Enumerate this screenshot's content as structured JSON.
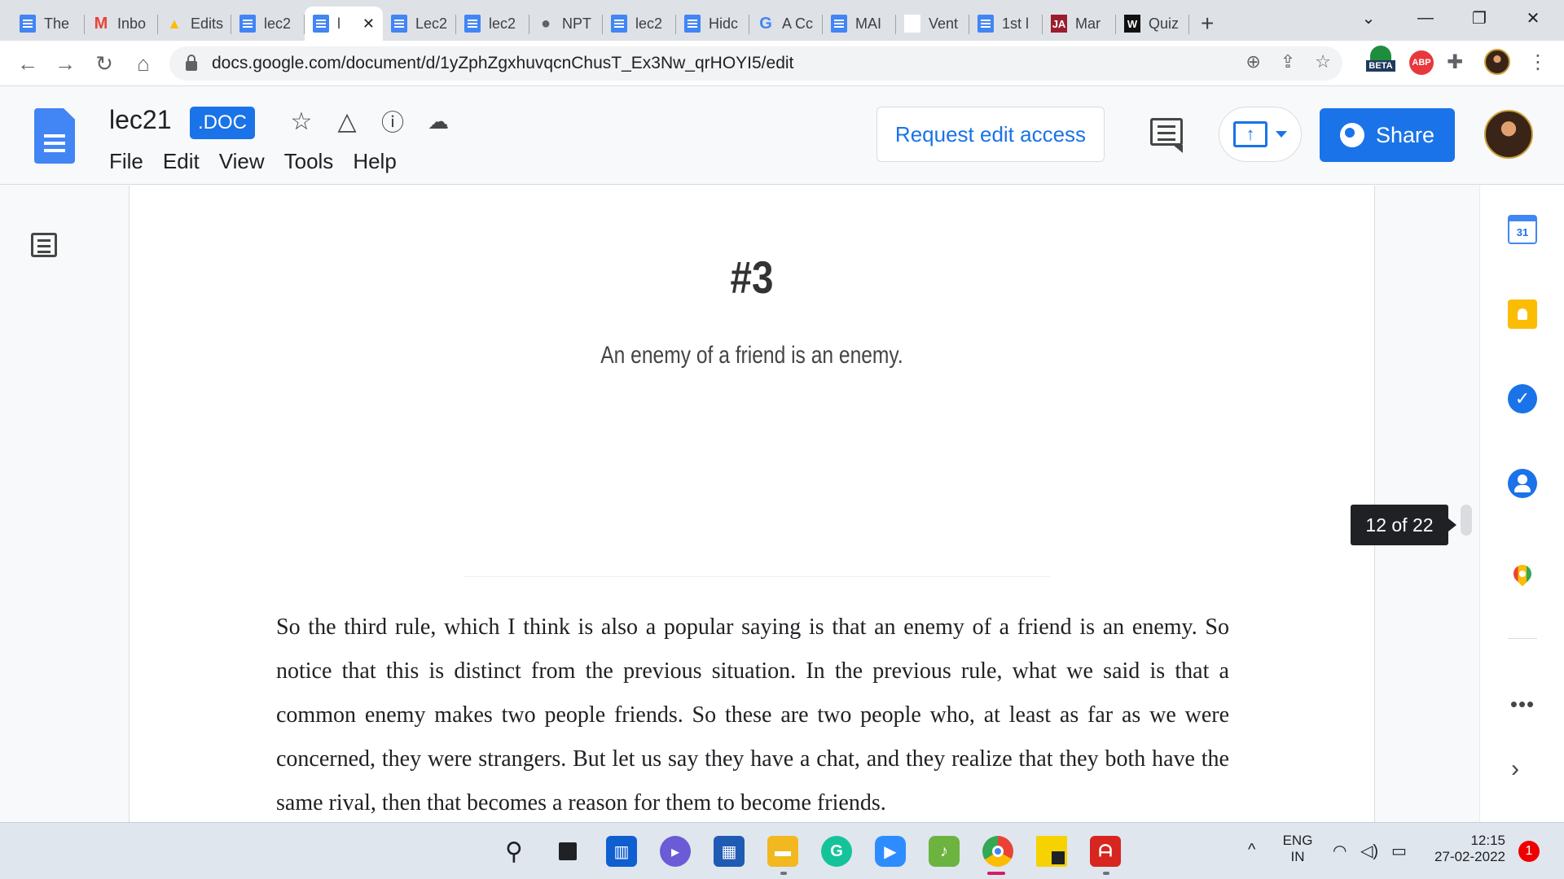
{
  "browser": {
    "tabs": [
      {
        "label": "The",
        "icon": "docs",
        "color": "#4285f4"
      },
      {
        "label": "Inbo",
        "icon": "gmail",
        "color": "#ea4335"
      },
      {
        "label": "Edits",
        "icon": "drive",
        "color": "#fbbc04"
      },
      {
        "label": "lec2",
        "icon": "docs",
        "color": "#4285f4"
      },
      {
        "label": "l",
        "icon": "docs",
        "color": "#4285f4",
        "active": true
      },
      {
        "label": "Lec2",
        "icon": "docs",
        "color": "#4285f4"
      },
      {
        "label": "lec2",
        "icon": "docs",
        "color": "#4285f4"
      },
      {
        "label": "NPT",
        "icon": "globe",
        "color": "#5f6368"
      },
      {
        "label": "lec2",
        "icon": "docs",
        "color": "#4285f4"
      },
      {
        "label": "Hidc",
        "icon": "docs",
        "color": "#4285f4"
      },
      {
        "label": "A Cc",
        "icon": "google",
        "color": "#4285f4"
      },
      {
        "label": "MAI",
        "icon": "docs",
        "color": "#4285f4"
      },
      {
        "label": "Vent",
        "icon": "blank",
        "color": "#ffffff"
      },
      {
        "label": "1st l",
        "icon": "docs",
        "color": "#4285f4"
      },
      {
        "label": "Mar",
        "icon": "ja",
        "color": "#9b1c2e"
      },
      {
        "label": "Quiz",
        "icon": "w",
        "color": "#111111"
      }
    ],
    "new_tab": "+",
    "url": "docs.google.com/document/d/1yZphZgxhuvqcnChusT_Ex3Nw_qrHOYI5/edit",
    "ext_beta_label": "BETA",
    "ext_abp_label": "ABP"
  },
  "docs": {
    "title": "lec21",
    "badge": ".DOC",
    "menu": [
      "File",
      "Edit",
      "View",
      "Tools",
      "Help"
    ],
    "request_edit": "Request edit access",
    "share": "Share"
  },
  "document": {
    "slide_heading": "#3",
    "slide_subtitle": "An enemy of a friend is an enemy.",
    "paragraph": "So the third rule, which I think is also a popular saying is that an enemy of a friend is an enemy. So notice that this is distinct from the previous situation. In the previous rule, what we said is that a common enemy makes two people friends. So these are two people who, at least as far as we were concerned, they were strangers. But let us say they have a chat, and they realize that they both have the same rival, then that becomes a reason for them to become friends.",
    "page_indicator": "12 of 22"
  },
  "side_panel": {
    "calendar_day": "31",
    "more": "•••",
    "expand": "›"
  },
  "taskbar": {
    "lang_top": "ENG",
    "lang_bottom": "IN",
    "time": "12:15",
    "date": "27-02-2022",
    "notifications": "1",
    "tray_caret": "^"
  }
}
